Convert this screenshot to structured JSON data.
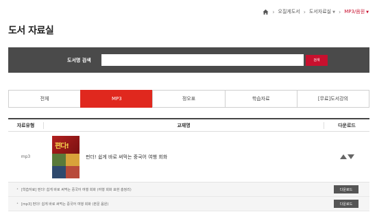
{
  "breadcrumb": {
    "items": [
      "오질게도서",
      "도서자료실",
      "MP3/음원"
    ]
  },
  "page_title": "도서 자료실",
  "search": {
    "label": "도서명 검색",
    "placeholder": "",
    "button_label": "검색"
  },
  "tabs": [
    "전체",
    "MP3",
    "정오표",
    "학습자료",
    "[무료]도서강의"
  ],
  "table": {
    "headers": {
      "type": "자료유형",
      "book": "교재명",
      "download": "다운로드"
    },
    "rows": [
      {
        "type": "mp3",
        "cover_title": "편다!",
        "title": "펀더! 쉽게 바로 써먹는 중국어 여행 회화",
        "files": [
          {
            "text": "[학습자료] 펀더! 쉽게 바로 써먹는 중국어 여행 회화 (여행 회화 표현 총정리)",
            "button": "다운로드"
          },
          {
            "text": "[mp3] 펀더! 쉽게 바로 써먹는 중국어 여행 회화 (본문 음원)",
            "button": "다운로드"
          }
        ]
      }
    ]
  },
  "colors": {
    "accent": "#c8102e",
    "tab_active": "#e0281e",
    "search_bg": "#4a4a4a"
  }
}
